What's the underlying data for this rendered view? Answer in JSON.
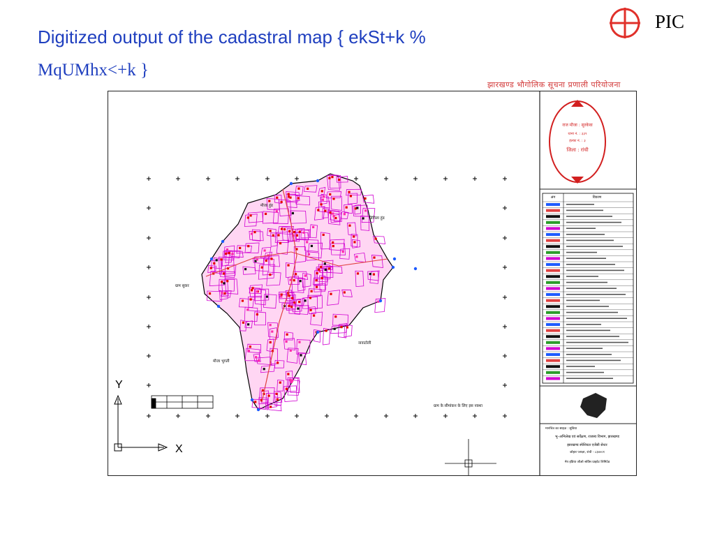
{
  "slide": {
    "title_line1": "Digitized output  of the  cadastral map { ekSt+k %",
    "title_line2": "MqUMhx<+k }"
  },
  "brand": {
    "name": "PIC",
    "logo_icon": "crosshair-circle-logo-icon",
    "logo_color": "#e0302a"
  },
  "map": {
    "header": "झारखण्ड भौगोलिक सूचना प्रणाली परियोजना",
    "stamp_lines": [
      "राज मौजा : सुरकेवा",
      "थाना नं. : ३३९",
      "हल्का नं. : ३",
      "जिला : रांची"
    ],
    "village_labels": [
      "मौजा हुंड",
      "डिगिला हुंड",
      "ग्राम सुकर",
      "नावाटोली",
      "मौजा भुगती"
    ],
    "legend_heading": [
      "अंग",
      "विवरण"
    ],
    "north_arrow_letter": "X",
    "y_axis_letter": "Y",
    "scale_note": "ग्राम के सीमांकन के लिए इस नक्शा",
    "bottom_block": {
      "line1": "मानचित्र का साइज़ : सुविधा",
      "line2": "भू–अभिलेख एवं सर्वेक्षण, राजस्व विभाग, झारखण्ड",
      "line3": "झारखण्ड स्पेशियल एजेंसी सेन्टर",
      "line4": "जोहार प्लाज़ा, रांची - ८३४००१",
      "line5": "मेप इंडिया जीओ सर्विस प्राइवेट लिमिटेड"
    },
    "colors": {
      "parcel_line": "#d100d1",
      "parcel_fill": "#ff46c4",
      "plot_marker": "#e60000",
      "water_marker": "#1e5bff",
      "stamp": "#d21f1f"
    }
  }
}
